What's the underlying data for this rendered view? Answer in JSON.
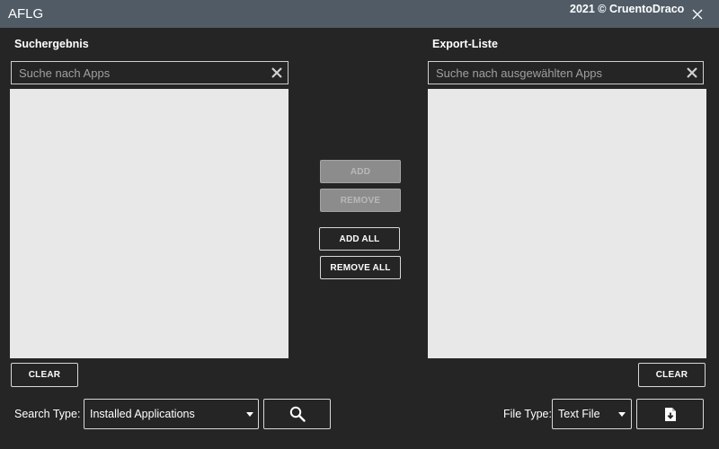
{
  "window": {
    "title": "AFLG",
    "copyright": "2021 © CruentoDraco"
  },
  "left_panel": {
    "label": "Suchergebnis",
    "search_placeholder": "Suche nach Apps",
    "search_value": "",
    "items": [],
    "clear_label": "CLEAR"
  },
  "right_panel": {
    "label": "Export-Liste",
    "search_placeholder": "Suche nach ausgewählten Apps",
    "search_value": "",
    "items": [],
    "clear_label": "CLEAR"
  },
  "transfer": {
    "add_label": "ADD",
    "remove_label": "REMOVE",
    "add_all_label": "ADD ALL",
    "remove_all_label": "REMOVE ALL"
  },
  "footer": {
    "search_type_label": "Search Type:",
    "search_type_value": "Installed Applications",
    "file_type_label": "File Type:",
    "file_type_value": "Text File"
  },
  "icons": {
    "close": "close-icon",
    "clear_search": "x-icon",
    "search": "search-icon",
    "export": "file-download-icon",
    "dropdown": "chevron-down-icon"
  },
  "colors": {
    "background": "#252526",
    "titlebar": "#505b66",
    "list_background": "#e8e8e8",
    "disabled_button": "#8c8c8c"
  }
}
